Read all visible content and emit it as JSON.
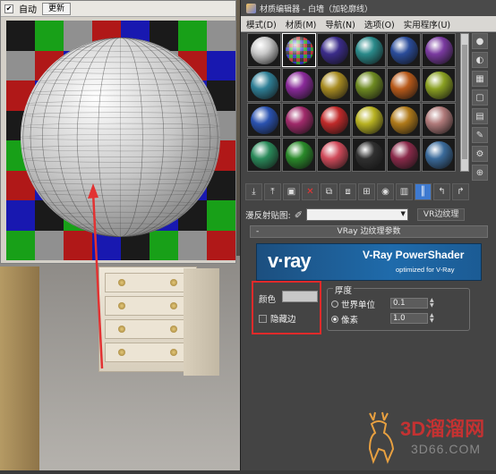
{
  "preview": {
    "auto_label": "自动",
    "update_label": "更新"
  },
  "editor": {
    "title": "材质编辑器 - 白墙（加轮廓线）",
    "menu": [
      "模式(D)",
      "材质(M)",
      "导航(N)",
      "选项(O)",
      "实用程序(U)"
    ],
    "map_label": "漫反射贴图:",
    "map_name": "VR边纹理",
    "rollout_title": "VRay 边纹理参数",
    "banner": {
      "logo": "v·ray",
      "title": "V-Ray PowerShader",
      "subtitle": "optimized for V-Ray"
    },
    "color_label": "颜色",
    "hide_label": "隐藏边",
    "thickness_label": "厚度",
    "world_units_label": "世界单位",
    "world_units_value": "0.1",
    "pixels_label": "像素",
    "pixels_value": "1.0",
    "slot_colors": [
      "#c8c8c8",
      "checker",
      "#3b2c8a",
      "#2a8a8a",
      "#2a4c9a",
      "#7a3aa0",
      "#2f7f96",
      "#8a2a9a",
      "#a88c22",
      "#6e8a22",
      "#b85a1a",
      "#8aa022",
      "#2a52b0",
      "#a02a6a",
      "#c02a2a",
      "#b8b222",
      "#b07a1a",
      "#b07a7a",
      "#2a8a5a",
      "#2a8a2a",
      "#d04a5a",
      "#303030",
      "#8a2a4a",
      "#3a6a9a"
    ]
  },
  "watermark": {
    "text": "3D溜溜网",
    "url": "3D66.COM"
  }
}
